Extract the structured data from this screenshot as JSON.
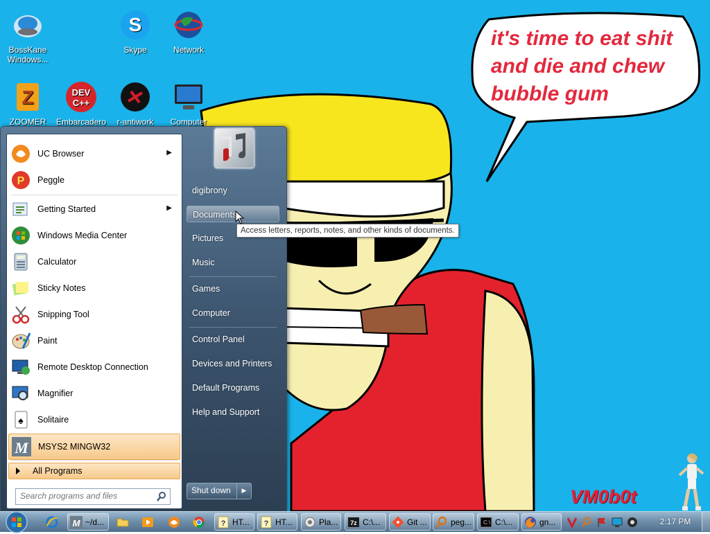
{
  "desktop": {
    "icons": [
      {
        "label": "BossKane Windows..."
      },
      {
        "label": "Skype"
      },
      {
        "label": "Network"
      },
      {
        "label": "ZOOMER"
      },
      {
        "label": "Embarcadero"
      },
      {
        "label": "r-antiwork"
      },
      {
        "label": "Computer"
      }
    ],
    "bubble_text": "it's time to eat shit and die and chew bubble gum",
    "signature": "VM0b0t"
  },
  "start_menu": {
    "programs": [
      {
        "label": "UC Browser"
      },
      {
        "label": "Peggle"
      },
      {
        "label": "Getting Started"
      },
      {
        "label": "Windows Media Center"
      },
      {
        "label": "Calculator"
      },
      {
        "label": "Sticky Notes"
      },
      {
        "label": "Snipping Tool"
      },
      {
        "label": "Paint"
      },
      {
        "label": "Remote Desktop Connection"
      },
      {
        "label": "Magnifier"
      },
      {
        "label": "Solitaire"
      },
      {
        "label": "MSYS2 MINGW32"
      }
    ],
    "all_programs": "All Programs",
    "search_placeholder": "Search programs and files",
    "user_name": "digibrony",
    "right_items": [
      {
        "label": "Documents"
      },
      {
        "label": "Pictures"
      },
      {
        "label": "Music"
      },
      {
        "label": "Games"
      },
      {
        "label": "Computer"
      },
      {
        "label": "Control Panel"
      },
      {
        "label": "Devices and Printers"
      },
      {
        "label": "Default Programs"
      },
      {
        "label": "Help and Support"
      }
    ],
    "shutdown_label": "Shut down",
    "tooltip": "Access letters, reports, notes, and other kinds of documents."
  },
  "taskbar": {
    "buttons": [
      {
        "label": "~/d..."
      },
      {
        "label": "HT..."
      },
      {
        "label": "HT..."
      },
      {
        "label": "Pla..."
      },
      {
        "label": "C:\\..."
      },
      {
        "label": "Git ..."
      },
      {
        "label": "peg..."
      },
      {
        "label": "C:\\..."
      },
      {
        "label": "gn..."
      }
    ],
    "clock": "2:17 PM"
  },
  "colors": {
    "desktop_bg": "#1ab2ea",
    "bubble_text": "#e3283d",
    "hat_yellow": "#f7e51e",
    "shirt_red": "#e4222e",
    "skin": "#f7efb0"
  }
}
